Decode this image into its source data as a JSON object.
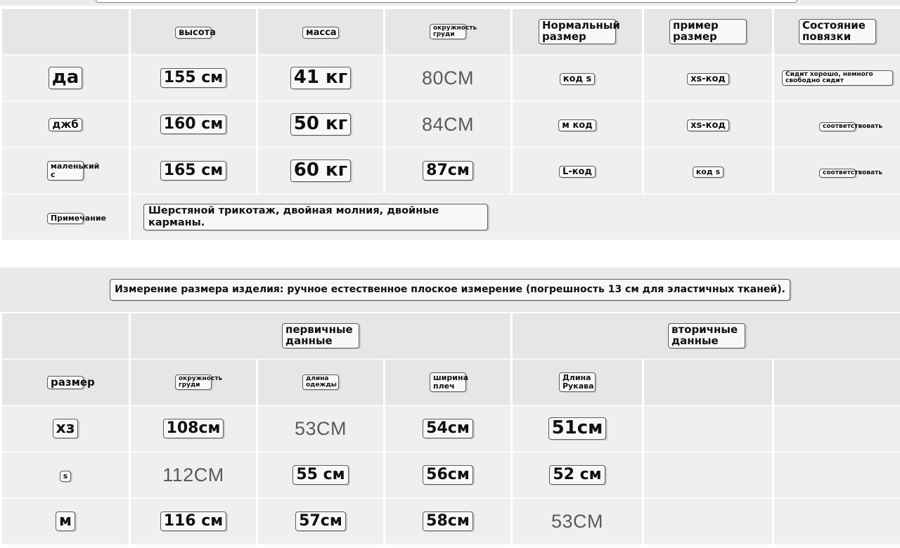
{
  "size_table": {
    "headers": [
      "",
      "высота",
      "масса",
      "окружность груди",
      "Нормальный размер",
      "пример размер",
      "Состояние повязки"
    ],
    "rows": [
      {
        "label": "да",
        "height": "155 см",
        "weight": "41 кг",
        "chest": "80CM",
        "normal_size": "код s",
        "sample_size": "xs-код",
        "fit": "Сидит хорошо, немного свободно сидит"
      },
      {
        "label": "джб",
        "height": "160 см",
        "weight": "50 кг",
        "chest": "84CM",
        "normal_size": "м код",
        "sample_size": "xs-код",
        "fit": "соответствовать"
      },
      {
        "label": "маленький с",
        "height": "165 см",
        "weight": "60 кг",
        "chest": "87см",
        "normal_size": "L-код",
        "sample_size": "код s",
        "fit": "соответствовать"
      }
    ],
    "note_label": "Примечание",
    "note_text": "Шерстяной трикотаж, двойная молния, двойные карманы."
  },
  "measurement_banner": "Измерение размера изделия: ручное естественное плоское измерение (погрешность 13 см для эластичных тканей).",
  "measure_table": {
    "group_primary": "первичные данные",
    "group_secondary": "вторичные данные",
    "headers": [
      "размер",
      "окружность груди",
      "длина одежды",
      "ширина плеч",
      "Длина Рукава",
      "",
      ""
    ],
    "rows": [
      {
        "size": "хз",
        "chest": "108см",
        "length": "53CM",
        "shoulder": "54см",
        "sleeve": "51см"
      },
      {
        "size": "s",
        "chest": "112CM",
        "length": "55 см",
        "shoulder": "56см",
        "sleeve": "52 см"
      },
      {
        "size": "м",
        "chest": "116 см",
        "length": "57см",
        "shoulder": "58см",
        "sleeve": "53CM"
      }
    ]
  }
}
